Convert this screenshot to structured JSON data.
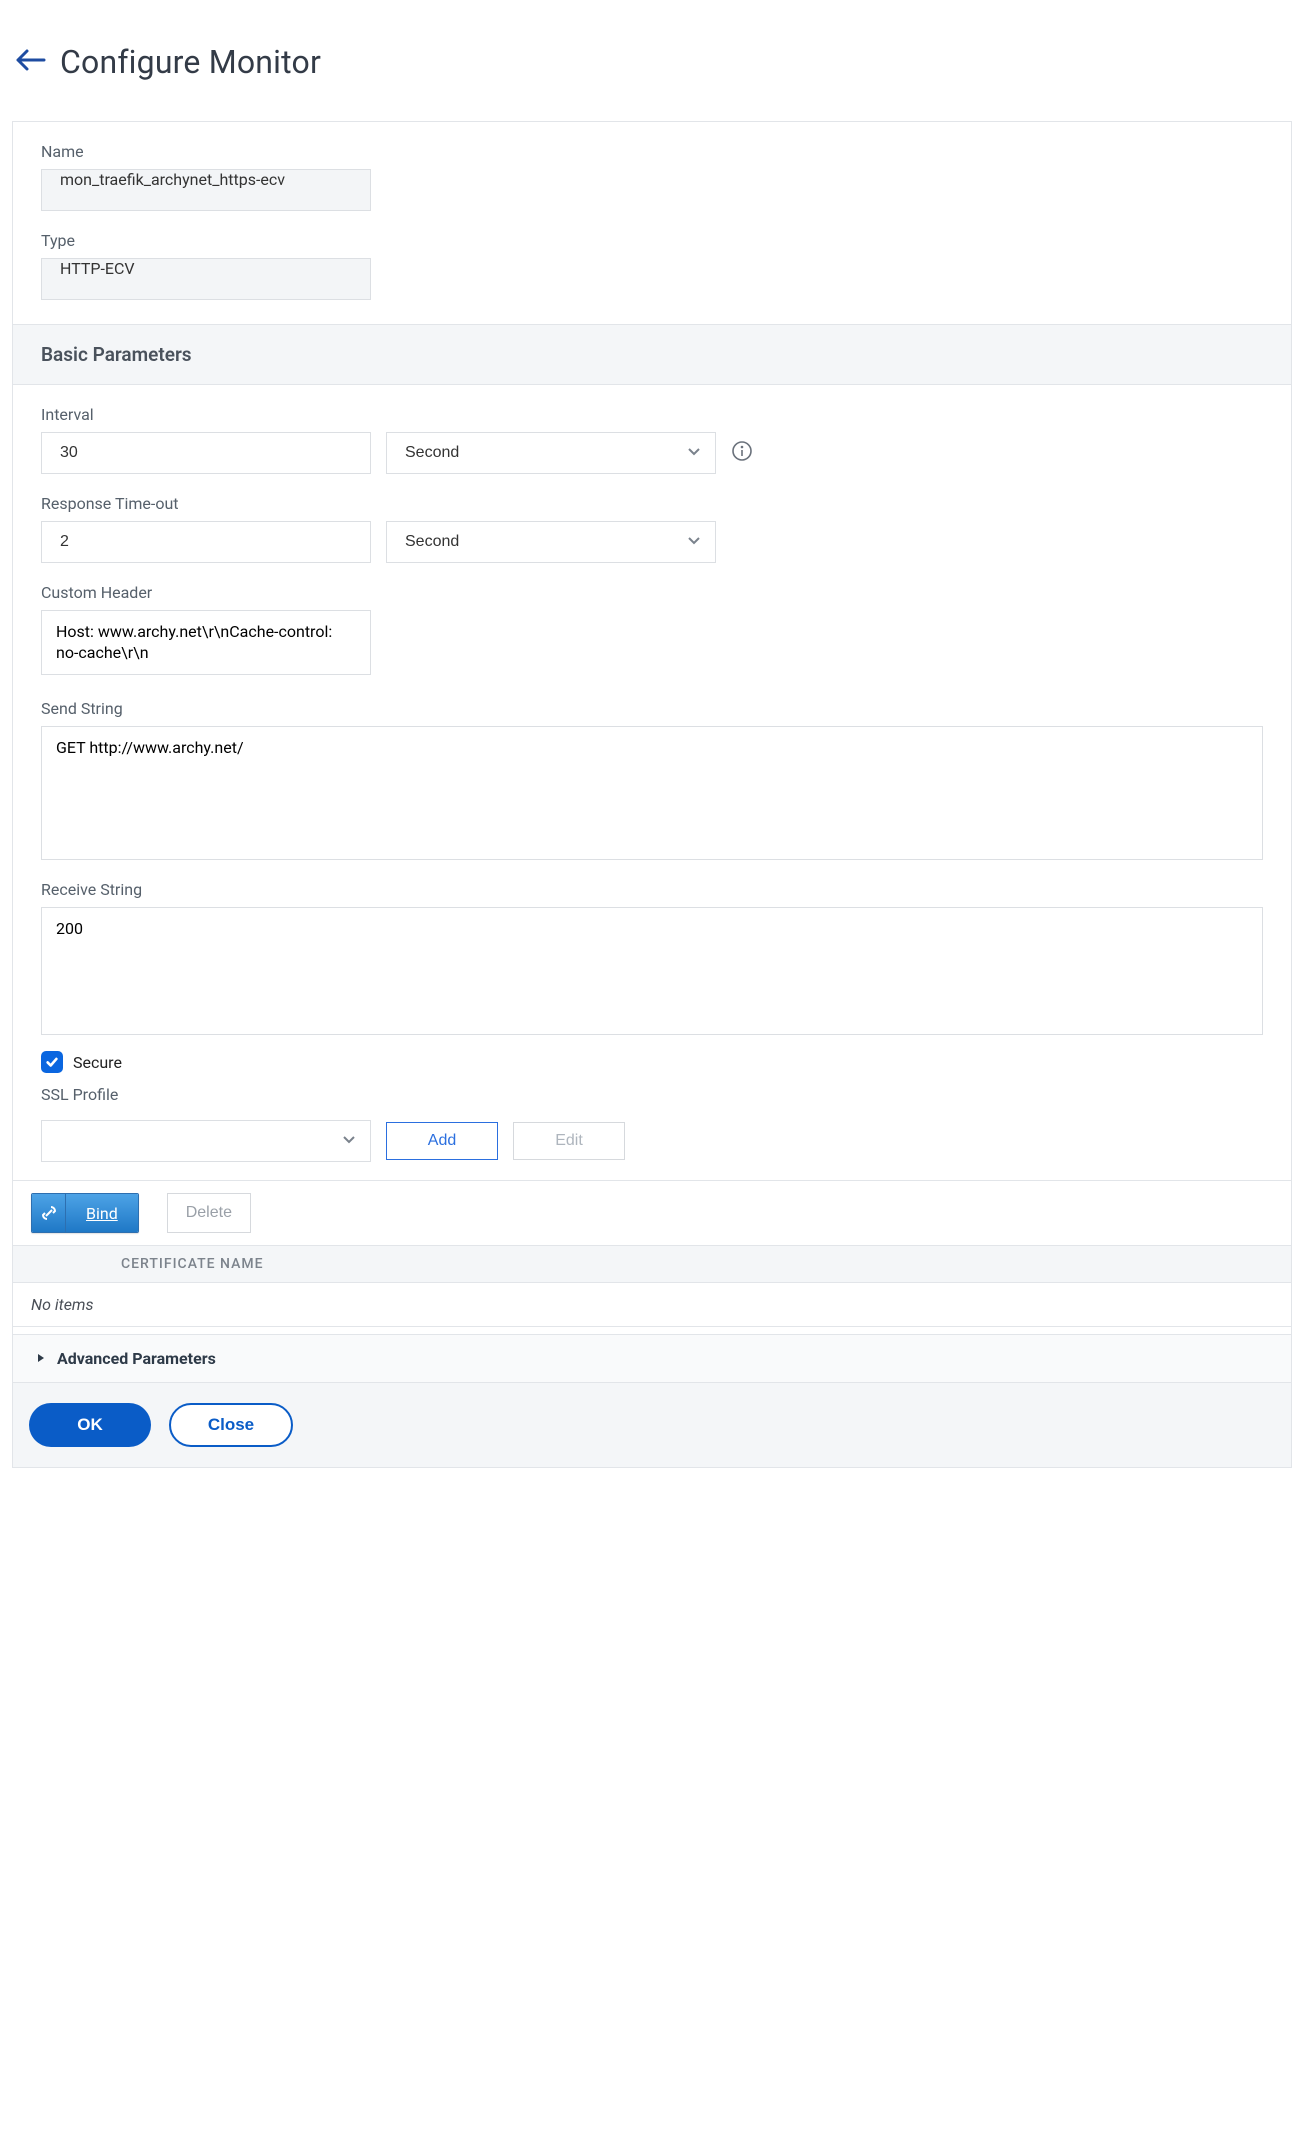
{
  "header": {
    "title": "Configure Monitor"
  },
  "top": {
    "name_label": "Name",
    "name_value": "mon_traefik_archynet_https-ecv",
    "type_label": "Type",
    "type_value": "HTTP-ECV"
  },
  "section_basic": {
    "heading": "Basic Parameters",
    "interval_label": "Interval",
    "interval_value": "30",
    "interval_unit": "Second",
    "timeout_label": "Response Time-out",
    "timeout_value": "2",
    "timeout_unit": "Second",
    "custom_header_label": "Custom Header",
    "custom_header_value": "Host: www.archy.net\\r\\nCache-control: no-cache\\r\\n",
    "send_string_label": "Send String",
    "send_string_value": "GET http://www.archy.net/",
    "receive_string_label": "Receive String",
    "receive_string_value": "200",
    "secure_label": "Secure",
    "secure_checked": true,
    "ssl_profile_label": "SSL Profile",
    "ssl_profile_value": "",
    "add_label": "Add",
    "edit_label": "Edit"
  },
  "cert_area": {
    "bind_label": "Bind",
    "delete_label": "Delete",
    "column_name": "CERTIFICATE NAME",
    "empty_text": "No items"
  },
  "advanced": {
    "heading": "Advanced Parameters"
  },
  "footer": {
    "ok_label": "OK",
    "close_label": "Close"
  }
}
